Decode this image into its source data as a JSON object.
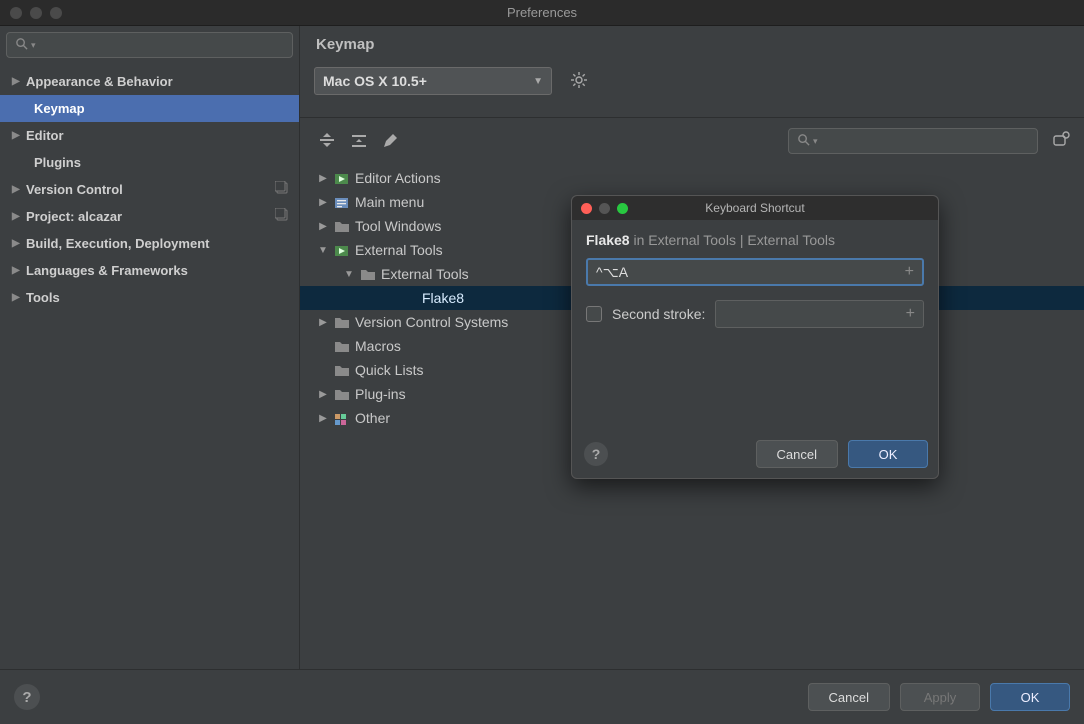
{
  "window": {
    "title": "Preferences"
  },
  "sidebar": {
    "search_placeholder": "",
    "items": [
      {
        "label": "Appearance & Behavior",
        "expandable": true
      },
      {
        "label": "Keymap",
        "selected": true,
        "child": true
      },
      {
        "label": "Editor",
        "expandable": true
      },
      {
        "label": "Plugins",
        "child": true
      },
      {
        "label": "Version Control",
        "expandable": true,
        "badge": true
      },
      {
        "label": "Project: alcazar",
        "expandable": true,
        "badge": true
      },
      {
        "label": "Build, Execution, Deployment",
        "expandable": true
      },
      {
        "label": "Languages & Frameworks",
        "expandable": true
      },
      {
        "label": "Tools",
        "expandable": true
      }
    ]
  },
  "page": {
    "title": "Keymap",
    "scheme": "Mac OS X 10.5+",
    "tree": [
      {
        "label": "Editor Actions",
        "icon": "run",
        "arrow": "right",
        "indent": 0
      },
      {
        "label": "Main menu",
        "icon": "menu",
        "arrow": "right",
        "indent": 0
      },
      {
        "label": "Tool Windows",
        "icon": "folder",
        "arrow": "right",
        "indent": 0
      },
      {
        "label": "External Tools",
        "icon": "run",
        "arrow": "down",
        "indent": 0
      },
      {
        "label": "External Tools",
        "icon": "folder",
        "arrow": "down",
        "indent": 1
      },
      {
        "label": "Flake8",
        "icon": "",
        "arrow": "",
        "indent": 3,
        "selected": true
      },
      {
        "label": "Version Control Systems",
        "icon": "folder",
        "arrow": "right",
        "indent": 0
      },
      {
        "label": "Macros",
        "icon": "folder",
        "arrow": "",
        "indent": 0
      },
      {
        "label": "Quick Lists",
        "icon": "folder",
        "arrow": "",
        "indent": 0
      },
      {
        "label": "Plug-ins",
        "icon": "folder",
        "arrow": "right",
        "indent": 0
      },
      {
        "label": "Other",
        "icon": "swatch",
        "arrow": "right",
        "indent": 0
      }
    ]
  },
  "modal": {
    "title": "Keyboard Shortcut",
    "context_strong": "Flake8",
    "context_rest": " in External Tools | External Tools",
    "first_stroke": "^⌥A",
    "second_stroke_label": "Second stroke:",
    "cancel": "Cancel",
    "ok": "OK"
  },
  "footer": {
    "cancel": "Cancel",
    "apply": "Apply",
    "ok": "OK"
  }
}
